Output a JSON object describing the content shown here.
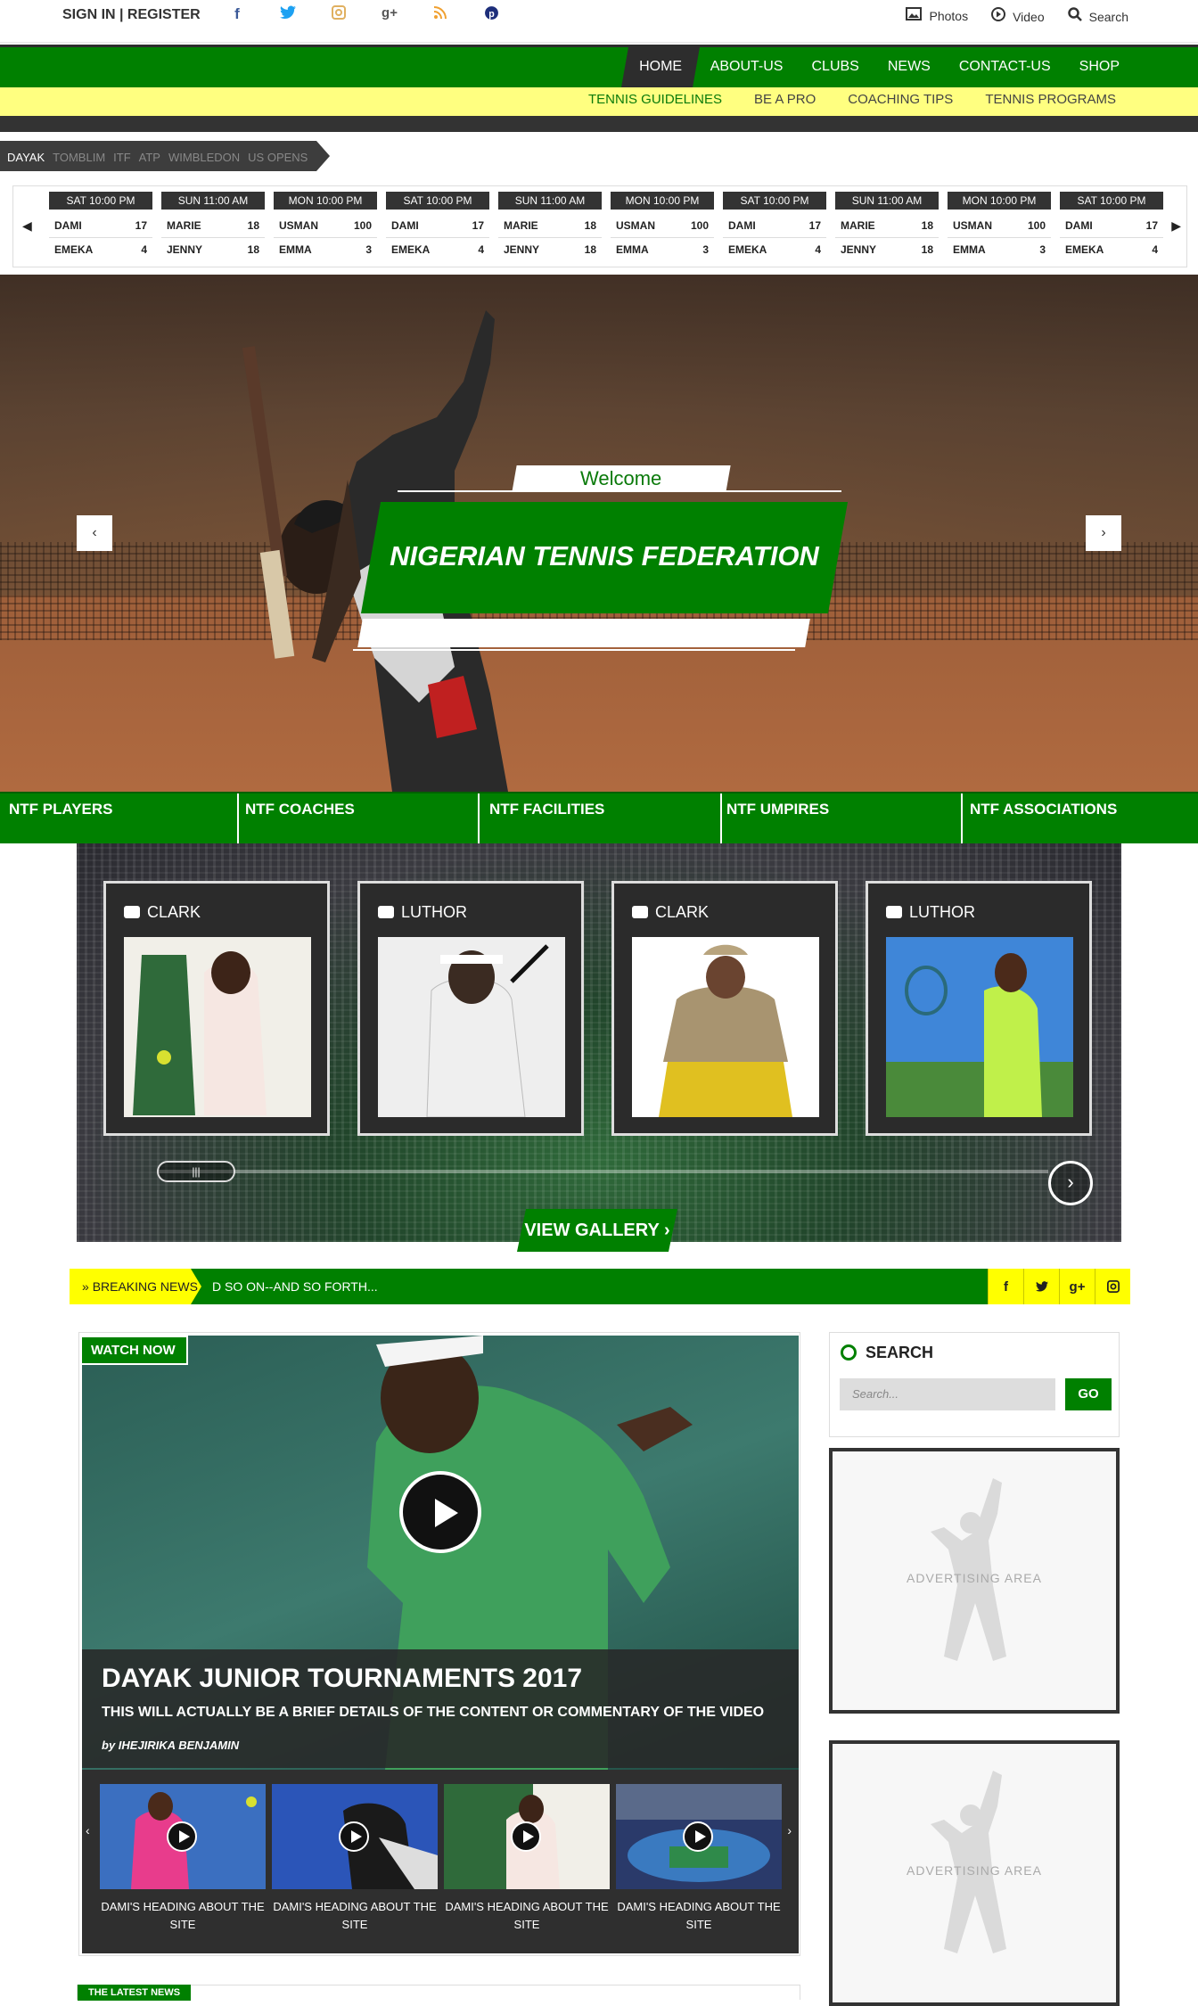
{
  "topbar": {
    "signin": "SIGN IN | REGISTER",
    "social_icons": [
      "facebook-icon",
      "twitter-icon",
      "instagram-icon",
      "google-plus-icon",
      "rss-icon",
      "pinterest-icon"
    ],
    "links": [
      {
        "icon": "photos-icon",
        "label": "Photos"
      },
      {
        "icon": "video-icon",
        "label": "Video"
      },
      {
        "icon": "search-icon",
        "label": "Search"
      }
    ]
  },
  "nav": {
    "items": [
      "HOME",
      "ABOUT-US",
      "CLUBS",
      "NEWS",
      "CONTACT-US",
      "SHOP"
    ],
    "active": "HOME",
    "subitems": [
      "TENNIS GUIDELINES",
      "BE A PRO",
      "COACHING TIPS",
      "TENNIS PROGRAMS"
    ]
  },
  "tour_tabs": [
    "DAYAK",
    "TOMBLIM",
    "ITF",
    "ATP",
    "WIMBLEDON",
    "US OPENS"
  ],
  "scores": [
    {
      "time": "SAT 10:00 PM",
      "p1": "DAMI",
      "s1": "17",
      "p2": "EMEKA",
      "s2": "4"
    },
    {
      "time": "SUN 11:00 AM",
      "p1": "MARIE",
      "s1": "18",
      "p2": "JENNY",
      "s2": "18"
    },
    {
      "time": "MON 10:00 PM",
      "p1": "USMAN",
      "s1": "100",
      "p2": "EMMA",
      "s2": "3"
    },
    {
      "time": "SAT 10:00 PM",
      "p1": "DAMI",
      "s1": "17",
      "p2": "EMEKA",
      "s2": "4"
    },
    {
      "time": "SUN 11:00 AM",
      "p1": "MARIE",
      "s1": "18",
      "p2": "JENNY",
      "s2": "18"
    },
    {
      "time": "MON 10:00 PM",
      "p1": "USMAN",
      "s1": "100",
      "p2": "EMMA",
      "s2": "3"
    },
    {
      "time": "SAT 10:00 PM",
      "p1": "DAMI",
      "s1": "17",
      "p2": "EMEKA",
      "s2": "4"
    },
    {
      "time": "SUN 11:00 AM",
      "p1": "MARIE",
      "s1": "18",
      "p2": "JENNY",
      "s2": "18"
    },
    {
      "time": "MON 10:00 PM",
      "p1": "USMAN",
      "s1": "100",
      "p2": "EMMA",
      "s2": "3"
    },
    {
      "time": "SAT 10:00 PM",
      "p1": "DAMI",
      "s1": "17",
      "p2": "EMEKA",
      "s2": "4"
    }
  ],
  "hero": {
    "welcome": "Welcome",
    "title": "NIGERIAN TENNIS FEDERATION"
  },
  "categories": [
    "NTF PLAYERS",
    "NTF COACHES",
    "NTF FACILITIES",
    "NTF UMPIRES",
    "NTF ASSOCIATIONS"
  ],
  "gallery": {
    "cards": [
      "CLARK",
      "LUTHOR",
      "CLARK",
      "LUTHOR"
    ],
    "view_label": "VIEW GALLERY"
  },
  "breaking": {
    "label": "BREAKING NEWS",
    "text": "D SO ON--AND SO FORTH..."
  },
  "video": {
    "watch_now": "WATCH NOW",
    "title": "DAYAK JUNIOR TOURNAMENTS 2017",
    "subtitle": "THIS WILL ACTUALLY BE A BRIEF DETAILS OF THE CONTENT OR COMMENTARY OF THE VIDEO",
    "byline": "by IHEJIRIKA BENJAMIN",
    "thumbs": [
      {
        "title": "DAMI'S HEADING ABOUT THE SITE"
      },
      {
        "title": "DAMI'S HEADING ABOUT THE SITE"
      },
      {
        "title": "DAMI'S HEADING ABOUT THE SITE"
      },
      {
        "title": "DAMI'S HEADING ABOUT THE SITE"
      }
    ]
  },
  "sidebar": {
    "search_heading": "SEARCH",
    "search_placeholder": "Search...",
    "go": "GO",
    "ads": [
      "ADVERTISING AREA",
      "ADVERTISING AREA"
    ]
  },
  "latest_news": "THE LATEST NEWS",
  "colors": {
    "brand_green": "#008000",
    "accent_yellow": "#ffff80",
    "dark": "#2d2d2d"
  }
}
